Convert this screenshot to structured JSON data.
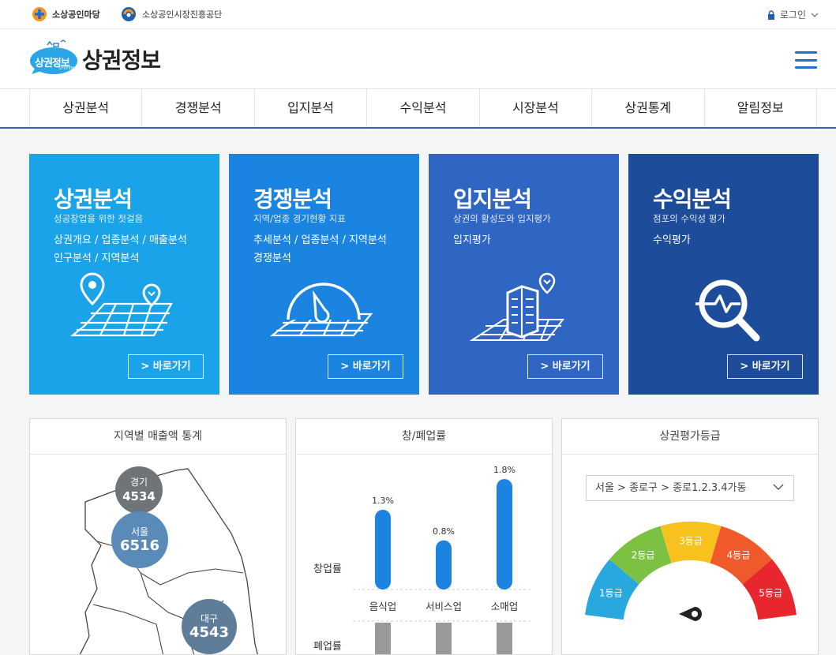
{
  "topbar": {
    "brand1": "소상공인마당",
    "brand2": "소상공인시장진흥공단",
    "login": "로그인"
  },
  "header": {
    "logo_badge": "상권정보",
    "logo_badge_small": "SYSTEM",
    "logo_text": "상권정보"
  },
  "nav": [
    "상권분석",
    "경쟁분석",
    "입지분석",
    "수익분석",
    "시장분석",
    "상권통계",
    "알림정보"
  ],
  "tiles": [
    {
      "title": "상권분석",
      "subtitle": "성공창업을 위한 첫걸음",
      "links": [
        "상권개요 / 업종분석 / 매출분석",
        "인구분석 / 지역분석"
      ],
      "icon": "map-pin-grid-icon",
      "button": "> 바로가기",
      "color": "#1aa3e8"
    },
    {
      "title": "경쟁분석",
      "subtitle": "지역/업종 경기현황 지표",
      "links": [
        "추세분석 / 업종분석 / 지역분석",
        "경쟁분석"
      ],
      "icon": "gauge-grid-icon",
      "button": "> 바로가기",
      "color": "#1a84e0"
    },
    {
      "title": "입지분석",
      "subtitle": "상권의 활성도와 입지평가",
      "links": [
        "입지평가"
      ],
      "icon": "building-grid-icon",
      "button": "> 바로가기",
      "color": "#2f66c4"
    },
    {
      "title": "수익분석",
      "subtitle": "점포의 수익성 평가",
      "links": [
        "수익평가"
      ],
      "icon": "magnifier-pulse-icon",
      "button": "> 바로가기",
      "color": "#1c4c9a"
    }
  ],
  "panel_sales": {
    "title": "지역별 매출액 통계",
    "regions": [
      {
        "name": "경기",
        "value": "4534",
        "color": "#6e7478"
      },
      {
        "name": "서울",
        "value": "6516",
        "color": "#5a8ab8"
      },
      {
        "name": "대구",
        "value": "4543",
        "color": "#5f7d99"
      }
    ]
  },
  "panel_rate": {
    "title": "창/폐업률",
    "row_labels": [
      "창업률",
      "폐업률"
    ],
    "categories": [
      "음식업",
      "서비스업",
      "소매업"
    ],
    "open_rates": [
      1.3,
      0.8,
      1.8
    ],
    "open_labels": [
      "1.3%",
      "0.8%",
      "1.8%"
    ],
    "colors": {
      "open": "#1c84e0",
      "close": "#999999"
    }
  },
  "panel_grade": {
    "title": "상권평가등급",
    "location": "서울 > 종로구 > 종로1.2.3.4가동",
    "grades": [
      {
        "label": "1등급",
        "color": "#29a8e0"
      },
      {
        "label": "2등급",
        "color": "#7cc142"
      },
      {
        "label": "3등급",
        "color": "#f7c21e"
      },
      {
        "label": "4등급",
        "color": "#f0592a"
      },
      {
        "label": "5등급",
        "color": "#e8262d"
      }
    ]
  }
}
